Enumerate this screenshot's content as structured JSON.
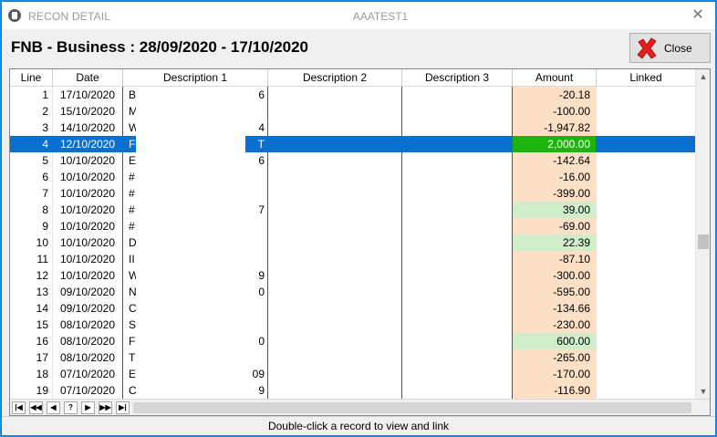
{
  "titlebar": {
    "app_title": "RECON DETAIL",
    "center_title": "AAATEST1",
    "close_glyph": "✕"
  },
  "heading": "FNB - Business : 28/09/2020 - 17/10/2020",
  "close_button": {
    "label": "Close"
  },
  "columns": [
    "Line",
    "Date",
    "Description 1",
    "Description 2",
    "Description 3",
    "Amount",
    "Linked"
  ],
  "rows": [
    {
      "line": "1",
      "date": "17/10/2020",
      "d1": "B",
      "d1_tail": "6",
      "amount": "-20.18",
      "positive": false
    },
    {
      "line": "2",
      "date": "15/10/2020",
      "d1": "M",
      "d1_tail": "",
      "amount": "-100.00",
      "positive": false
    },
    {
      "line": "3",
      "date": "14/10/2020",
      "d1": "W",
      "d1_tail": "4",
      "amount": "-1,947.82",
      "positive": false
    },
    {
      "line": "4",
      "date": "12/10/2020",
      "d1": "F",
      "d1_tail": "T",
      "amount": "2,000.00",
      "positive": true,
      "selected": true
    },
    {
      "line": "5",
      "date": "10/10/2020",
      "d1": "E",
      "d1_tail": "6",
      "amount": "-142.64",
      "positive": false
    },
    {
      "line": "6",
      "date": "10/10/2020",
      "d1": "#",
      "d1_tail": "",
      "amount": "-16.00",
      "positive": false
    },
    {
      "line": "7",
      "date": "10/10/2020",
      "d1": "#",
      "d1_tail": "",
      "amount": "-399.00",
      "positive": false
    },
    {
      "line": "8",
      "date": "10/10/2020",
      "d1": "#",
      "d1_tail": "7",
      "amount": "39.00",
      "positive": true
    },
    {
      "line": "9",
      "date": "10/10/2020",
      "d1": "#",
      "d1_tail": "",
      "amount": "-69.00",
      "positive": false
    },
    {
      "line": "10",
      "date": "10/10/2020",
      "d1": "D",
      "d1_tail": "",
      "amount": "22.39",
      "positive": true
    },
    {
      "line": "11",
      "date": "10/10/2020",
      "d1": "II",
      "d1_tail": "",
      "amount": "-87.10",
      "positive": false
    },
    {
      "line": "12",
      "date": "10/10/2020",
      "d1": "W",
      "d1_tail": "9",
      "amount": "-300.00",
      "positive": false
    },
    {
      "line": "13",
      "date": "09/10/2020",
      "d1": "N",
      "d1_tail": "0",
      "amount": "-595.00",
      "positive": false
    },
    {
      "line": "14",
      "date": "09/10/2020",
      "d1": "C",
      "d1_tail": "",
      "amount": "-134.66",
      "positive": false
    },
    {
      "line": "15",
      "date": "08/10/2020",
      "d1": "S",
      "d1_tail": "",
      "amount": "-230.00",
      "positive": false
    },
    {
      "line": "16",
      "date": "08/10/2020",
      "d1": "F",
      "d1_tail": "0",
      "amount": "600.00",
      "positive": true
    },
    {
      "line": "17",
      "date": "08/10/2020",
      "d1": "T",
      "d1_tail": "",
      "amount": "-265.00",
      "positive": false
    },
    {
      "line": "18",
      "date": "07/10/2020",
      "d1": "E",
      "d1_tail": "09",
      "amount": "-170.00",
      "positive": false
    },
    {
      "line": "19",
      "date": "07/10/2020",
      "d1": "C",
      "d1_tail": "9",
      "amount": "-116.90",
      "positive": false
    }
  ],
  "navigator": [
    "|◀",
    "◀◀",
    "◀",
    "?",
    "▶",
    "▶▶",
    "▶|"
  ],
  "status": "Double-click a record to view and link",
  "colors": {
    "selected_row": "#0a70d0",
    "negative_amount": "#fde0c6",
    "positive_amount": "#cfeec9",
    "selected_amount": "#1fb30f"
  }
}
